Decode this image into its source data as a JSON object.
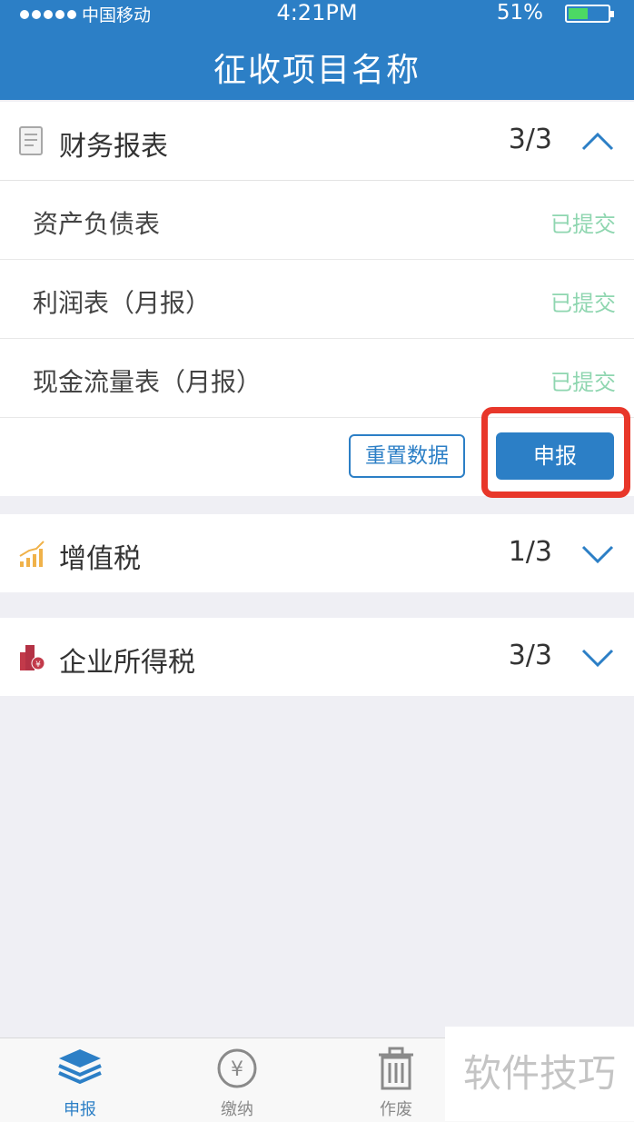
{
  "status_bar": {
    "carrier": "中国移动",
    "time": "4:21PM",
    "battery": "51%",
    "battery_level": 0.51
  },
  "header": {
    "title": "征收项目名称"
  },
  "sections": [
    {
      "label": "财务报表",
      "count": "3/3",
      "expanded": true,
      "icon": "document-icon",
      "items": [
        {
          "name": "资产负债表",
          "status": "已提交"
        },
        {
          "name": "利润表（月报）",
          "status": "已提交"
        },
        {
          "name": "现金流量表（月报）",
          "status": "已提交"
        }
      ],
      "reset_label": "重置数据",
      "declare_label": "申报"
    },
    {
      "label": "增值税",
      "count": "1/3",
      "expanded": false,
      "icon": "growth-chart-icon"
    },
    {
      "label": "企业所得税",
      "count": "3/3",
      "expanded": false,
      "icon": "tax-building-icon"
    }
  ],
  "tabbar": {
    "items": [
      {
        "label": "申报",
        "icon": "layers-icon",
        "active": true
      },
      {
        "label": "缴纳",
        "icon": "yen-coin-icon",
        "active": false
      },
      {
        "label": "作废",
        "icon": "trash-icon",
        "active": false
      }
    ]
  },
  "watermark": "软件技巧",
  "colors": {
    "primary": "#2c7fc6",
    "submitted": "#8fd6b0",
    "highlight": "#e8372a",
    "background": "#efeff4"
  }
}
